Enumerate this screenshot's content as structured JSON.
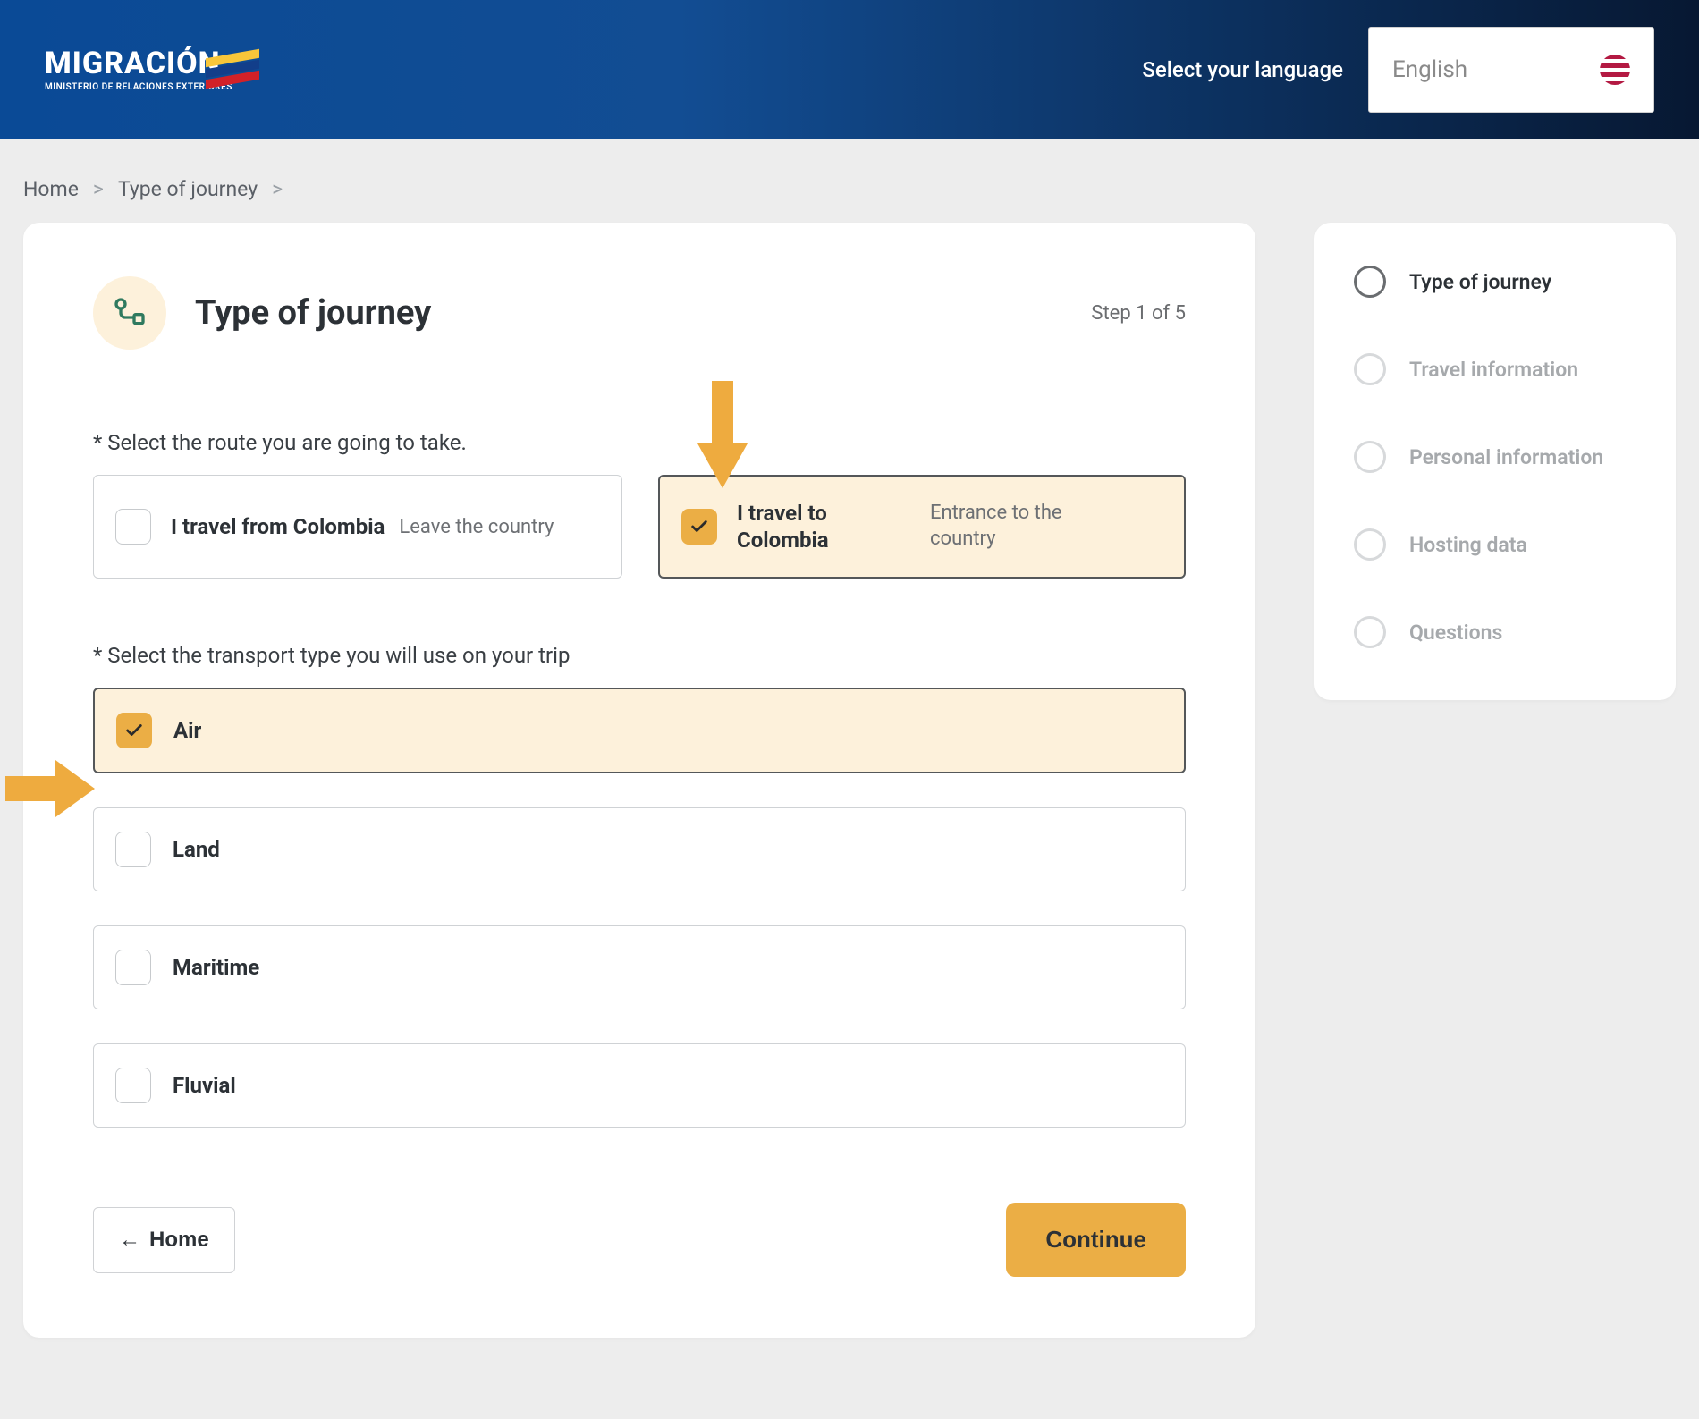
{
  "header": {
    "logo_main": "MIGRACIÓN",
    "logo_sub": "MINISTERIO DE RELACIONES EXTERIORES",
    "lang_label": "Select your language",
    "lang_value": "English"
  },
  "breadcrumbs": {
    "home": "Home",
    "current": "Type of journey"
  },
  "form": {
    "title": "Type of journey",
    "step_text": "Step 1 of 5",
    "route_label": "* Select the route you are going to take.",
    "transport_label": "* Select the transport type you will use on your trip",
    "routes": [
      {
        "main": "I travel from Colombia",
        "sub": "Leave the country",
        "selected": false
      },
      {
        "main": "I travel to Colombia",
        "sub": "Entrance to the country",
        "selected": true
      }
    ],
    "transports": [
      {
        "label": "Air",
        "selected": true
      },
      {
        "label": "Land",
        "selected": false
      },
      {
        "label": "Maritime",
        "selected": false
      },
      {
        "label": "Fluvial",
        "selected": false
      }
    ],
    "home_btn": "Home",
    "continue_btn": "Continue"
  },
  "steps": [
    {
      "label": "Type of journey",
      "active": true
    },
    {
      "label": "Travel information",
      "active": false
    },
    {
      "label": "Personal information",
      "active": false
    },
    {
      "label": "Hosting data",
      "active": false
    },
    {
      "label": "Questions",
      "active": false
    }
  ]
}
